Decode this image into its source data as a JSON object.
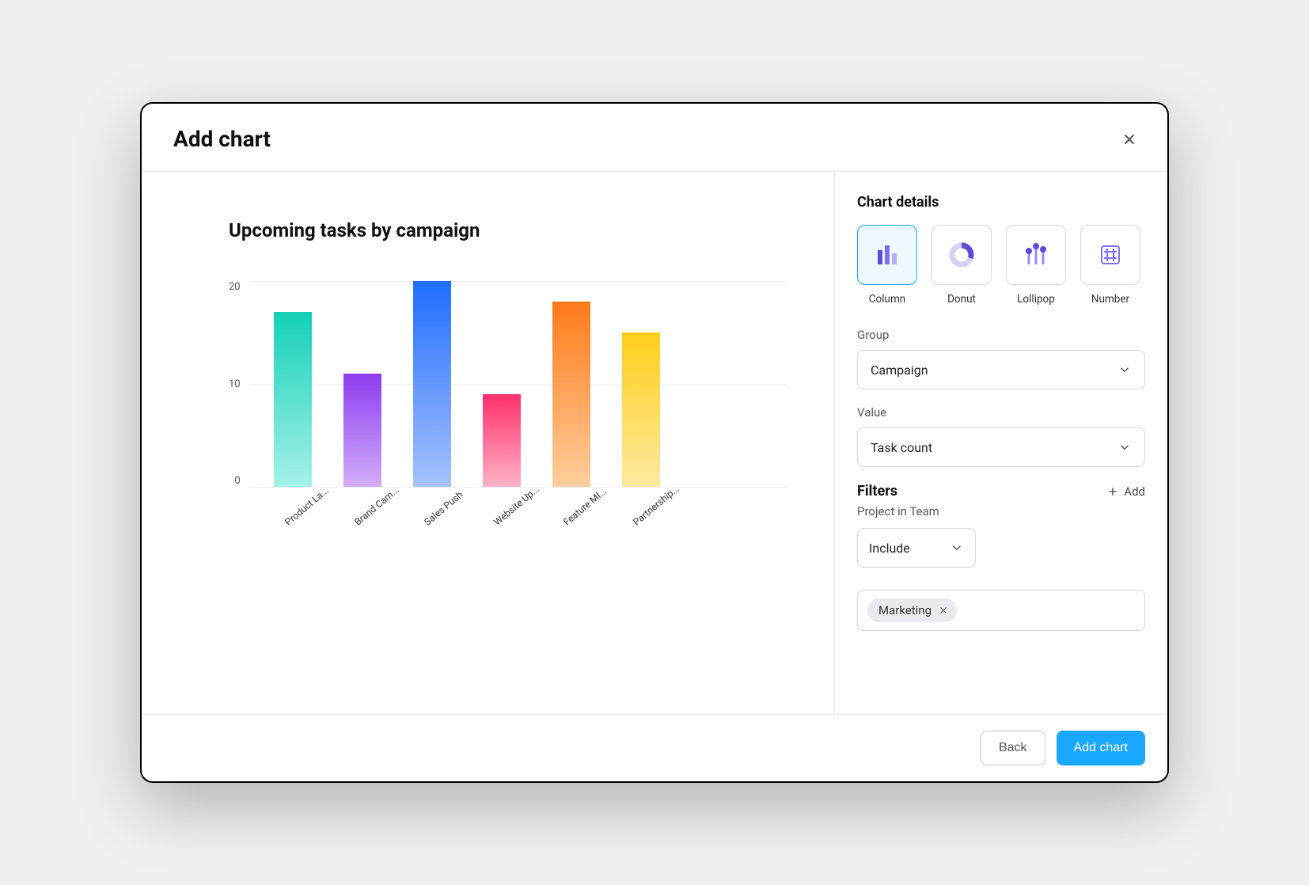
{
  "modal": {
    "title": "Add chart",
    "back_label": "Back",
    "submit_label": "Add chart"
  },
  "preview": {
    "chart_title": "Upcoming tasks by campaign"
  },
  "chart_data": {
    "type": "bar",
    "title": "Upcoming tasks by campaign",
    "xlabel": "",
    "ylabel": "",
    "ylim": [
      0,
      20
    ],
    "y_ticks": [
      20,
      10,
      0
    ],
    "categories": [
      "Product La...",
      "Brand Cam...",
      "Sales Push",
      "Website Up...",
      "Feature MI...",
      "Partnership..."
    ],
    "values": [
      17,
      11,
      20,
      9,
      18,
      15
    ]
  },
  "details": {
    "title": "Chart details",
    "chart_types": [
      {
        "key": "column",
        "label": "Column",
        "selected": true
      },
      {
        "key": "donut",
        "label": "Donut",
        "selected": false
      },
      {
        "key": "lollipop",
        "label": "Lollipop",
        "selected": false
      },
      {
        "key": "number",
        "label": "Number",
        "selected": false
      }
    ],
    "group_label": "Group",
    "group_value": "Campaign",
    "value_label": "Value",
    "value_value": "Task count",
    "filters_title": "Filters",
    "add_label": "Add",
    "filter_sub_label": "Project in Team",
    "filter_mode": "Include",
    "filter_tag": "Marketing"
  }
}
